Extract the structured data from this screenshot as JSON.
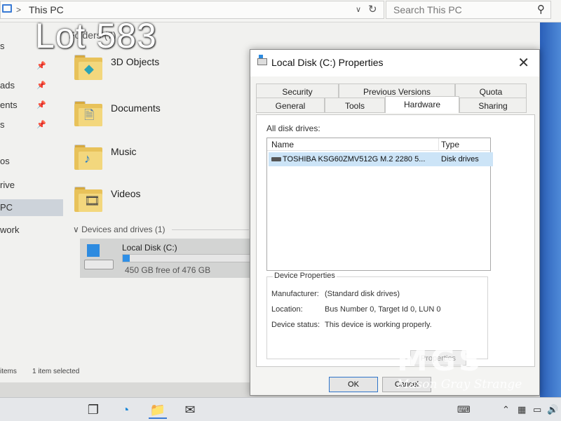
{
  "explorer": {
    "breadcrumb": "This PC",
    "search_placeholder": "Search This PC",
    "nav_items": [
      {
        "label": "s",
        "pinned": true
      },
      {
        "label": "",
        "pinned": true
      },
      {
        "label": "ads",
        "pinned": true
      },
      {
        "label": "ents",
        "pinned": true
      },
      {
        "label": "s",
        "pinned": true
      },
      {
        "label": "os",
        "pinned": false
      },
      {
        "label": "rive",
        "pinned": false
      },
      {
        "label": "PC",
        "pinned": false,
        "selected": true
      },
      {
        "label": "work",
        "pinned": false
      }
    ],
    "folders_header": "Folders (7)",
    "folders": [
      {
        "label": "3D Objects",
        "icon": "3d-objects-icon"
      },
      {
        "label": "Documents",
        "icon": "documents-icon"
      },
      {
        "label": "Music",
        "icon": "music-icon"
      },
      {
        "label": "Videos",
        "icon": "videos-icon"
      }
    ],
    "devices_header": "Devices and drives (1)",
    "drive": {
      "name": "Local Disk (C:)",
      "free_text": "450 GB free of 476 GB",
      "used_fraction": 0.055
    },
    "status": {
      "items": "items",
      "selected": "1 item selected"
    }
  },
  "overlay": {
    "lot": "Lot 583"
  },
  "dialog": {
    "title": "Local Disk (C:) Properties",
    "tabs_row1": [
      "Security",
      "Previous Versions",
      "Quota"
    ],
    "tabs_row2": [
      "General",
      "Tools",
      "Hardware",
      "Sharing"
    ],
    "active_tab": "Hardware",
    "all_disk_drives_label": "All disk drives:",
    "columns": [
      "Name",
      "Type"
    ],
    "rows": [
      {
        "name": "TOSHIBA KSG60ZMV512G M.2 2280 5...",
        "type": "Disk drives"
      }
    ],
    "device_properties": {
      "title": "Device Properties",
      "manufacturer_label": "Manufacturer:",
      "manufacturer": "(Standard disk drives)",
      "location_label": "Location:",
      "location": "Bus Number 0, Target Id 0, LUN 0",
      "status_label": "Device status:",
      "status": "This device is working properly."
    },
    "properties_button": "Properties",
    "ok_button": "OK",
    "cancel_button": "Cancel"
  },
  "watermark": {
    "logo": "MGS",
    "subtitle": "Mason Gray Strange"
  },
  "colors": {
    "selection": "#cce4f7",
    "drive_bar": "#2f8fe6",
    "ok_border": "#2f74c9"
  }
}
